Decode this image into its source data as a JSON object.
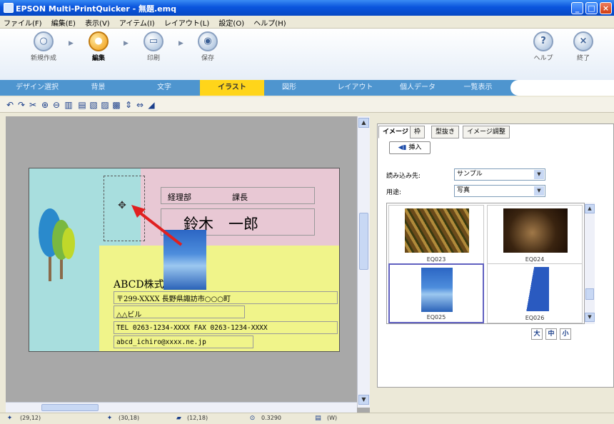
{
  "window": {
    "title": "EPSON Multi-PrintQuicker - 無題.emq"
  },
  "window_controls": {
    "minimize": "_",
    "maximize": "□",
    "close": "×"
  },
  "menu": [
    "ファイル(F)",
    "編集(E)",
    "表示(V)",
    "アイテム(I)",
    "レイアウト(L)",
    "設定(O)",
    "ヘルプ(H)"
  ],
  "nav": {
    "steps": [
      {
        "label": "新規作成",
        "icon": "new-file"
      },
      {
        "label": "編集",
        "icon": "edit",
        "active": true
      },
      {
        "label": "印刷",
        "icon": "print"
      },
      {
        "label": "保存",
        "icon": "save"
      }
    ],
    "help_label": "ヘルプ",
    "exit_label": "終了"
  },
  "tabs": [
    "デザイン選択",
    "背景",
    "文字",
    "イラスト",
    "図形",
    "レイアウト",
    "個人データ",
    "一覧表示"
  ],
  "active_tab": "イラスト",
  "card": {
    "dept": "経理部",
    "role": "課長",
    "name": "鈴木　一郎",
    "company": "ABCD株式会社",
    "address": "〒299-XXXX 長野県諏訪市○○○町",
    "building": "△△ビル",
    "phone": "TEL 0263-1234-XXXX FAX 0263-1234-XXXX",
    "email": "abcd_ichiro@xxxx.ne.jp"
  },
  "right_panel": {
    "tabs": [
      "イメージ",
      "枠",
      "型抜き",
      "イメージ調整"
    ],
    "insert_label": "挿入",
    "source_label": "読み込み先:",
    "source_value": "サンプル",
    "category_label": "用途:",
    "category_value": "写真",
    "thumbnails": [
      {
        "caption": "EQ023"
      },
      {
        "caption": "EQ024"
      },
      {
        "caption": "EQ025",
        "selected": true
      },
      {
        "caption": "EQ026"
      }
    ],
    "size_buttons": [
      "大",
      "中",
      "小"
    ]
  },
  "status": {
    "items": [
      "(29,12)",
      "(30,18)",
      "(12,18)",
      "0.3290",
      "(W)"
    ]
  },
  "colors": {
    "tab_bar": "#4e95cf",
    "active_tab": "#ffd51a",
    "card_teal": "#a8dede",
    "card_pink": "#e8c8d4",
    "card_yellow": "#f0f48a",
    "arrow": "#e02020"
  }
}
